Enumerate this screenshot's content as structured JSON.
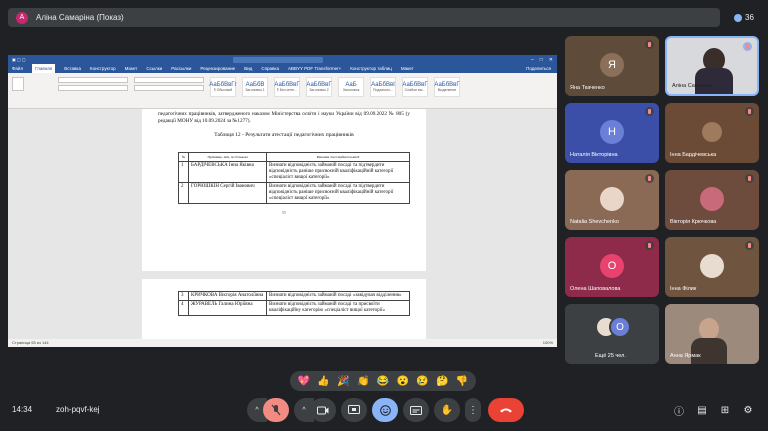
{
  "topbar": {
    "presenter_initial": "А",
    "presenter_label": "Аліна Самаріна (Показ)",
    "participant_count": "36"
  },
  "word": {
    "tabs": [
      "Файл",
      "Главная",
      "Вставка",
      "Конструктор",
      "Макет",
      "Ссылки",
      "Рассылки",
      "Рецензирование",
      "Вид",
      "Справка",
      "ABBYY PDF Transformer+",
      "Конструктор таблиц",
      "Макет"
    ],
    "active_tab": "Главная",
    "share_label": "Поделиться",
    "styles": [
      {
        "sample": "АаБбВвГг",
        "name": "¶ Обычный"
      },
      {
        "sample": "АаБбВ",
        "name": "Заголовок 1"
      },
      {
        "sample": "АаБбВвГ",
        "name": "¶ Без инте..."
      },
      {
        "sample": "АаБбВвГ",
        "name": "Заголовок 2"
      },
      {
        "sample": "АаБ",
        "name": "Заголовок"
      },
      {
        "sample": "АаБбВвІ",
        "name": "Подзаголо..."
      },
      {
        "sample": "АаБбВвГ",
        "name": "Слабое вы..."
      },
      {
        "sample": "АаБбВвГ",
        "name": "Выделение"
      }
    ],
    "intro_text": "педагогічних працівників, затвердженого наказом Міністерства освіти і науки України від 09.09.2022 № 805 (у редакції МОНУ від 10.09.2024 за №1277).",
    "table_caption": "Таблиця 12 - Результати атестації педагогічних працівників",
    "table_headers": [
      "№",
      "Прізвище, ім'я, по батькові",
      "Рішення атестаційної комісії"
    ],
    "rows_page1": [
      {
        "num": "1",
        "name": "БАРДІЧЕВСЬКА Інна Яківна",
        "decision": "Визнати відповідність займаній посаді та підтвердити відповідність раніше присвоєній кваліфікаційній категорії «спеціаліст вищої категорії»"
      },
      {
        "num": "2",
        "name": "ГОРЮШКІН Сергій Іванович",
        "decision": "Визнати відповідність займаній посаді та підтвердити відповідність раніше присвоєній кваліфікаційній категорії «спеціаліст вищої категорії»"
      }
    ],
    "page_number": "55",
    "rows_page2": [
      {
        "num": "3",
        "name": "КРИЧКОВА Вікторія Анатоліївна",
        "decision": "Визнати відповідність займаній посаді «завідувач відділення»"
      },
      {
        "num": "4",
        "name": "ЖУРАВЕЛЬ Галина Юріївна",
        "decision": "Визнати відповідність займаній посаді та присвоїти кваліфікаційну категорію «спеціаліст вищої категорії»"
      }
    ],
    "status_left": "Страница 55 из 144",
    "status_right": "100%"
  },
  "participants": [
    {
      "name": "Яна Ткаченко",
      "initial": "Я",
      "bg": "#5f4b3a",
      "avatar_bg": "#5f4b3a"
    },
    {
      "name": "Аліна Самаріна",
      "initial": "",
      "bg": "#d7d9dc",
      "avatar_bg": ""
    },
    {
      "name": "Наталія Вікторівна",
      "initial": "Н",
      "bg": "#3b4fa8",
      "avatar_bg": "#6b7fd6"
    },
    {
      "name": "Інна Бардічевська",
      "initial": "",
      "bg": "#6b4a36",
      "avatar_bg": ""
    },
    {
      "name": "Natalia Shevchenko",
      "initial": "",
      "bg": "#8b6a55",
      "avatar_bg": ""
    },
    {
      "name": "Вікторія Крючкова",
      "initial": "",
      "bg": "#6d4b3d",
      "avatar_bg": ""
    },
    {
      "name": "Олена Шаповалова",
      "initial": "О",
      "bg": "#8e2a4a",
      "avatar_bg": "#e8436f"
    },
    {
      "name": "Інна Філик",
      "initial": "",
      "bg": "#6f5440",
      "avatar_bg": ""
    },
    {
      "name": "Ещё 25 чел.",
      "initial": "О",
      "bg": "#3c4043",
      "avatar_bg": "#6b7fd6"
    },
    {
      "name": "Анна Ярмак",
      "initial": "",
      "bg": "#9c8a7c",
      "avatar_bg": ""
    }
  ],
  "reactions": [
    "💖",
    "👍",
    "🎉",
    "👏",
    "😂",
    "😮",
    "😢",
    "🤔",
    "👎"
  ],
  "bottom": {
    "time": "14:34",
    "meeting_code": "zoh-pqvf-kej"
  },
  "colors": {
    "background": "#202124",
    "word_blue": "#2b579a",
    "end_call": "#ea4335",
    "active_control": "#8ab4f8"
  }
}
